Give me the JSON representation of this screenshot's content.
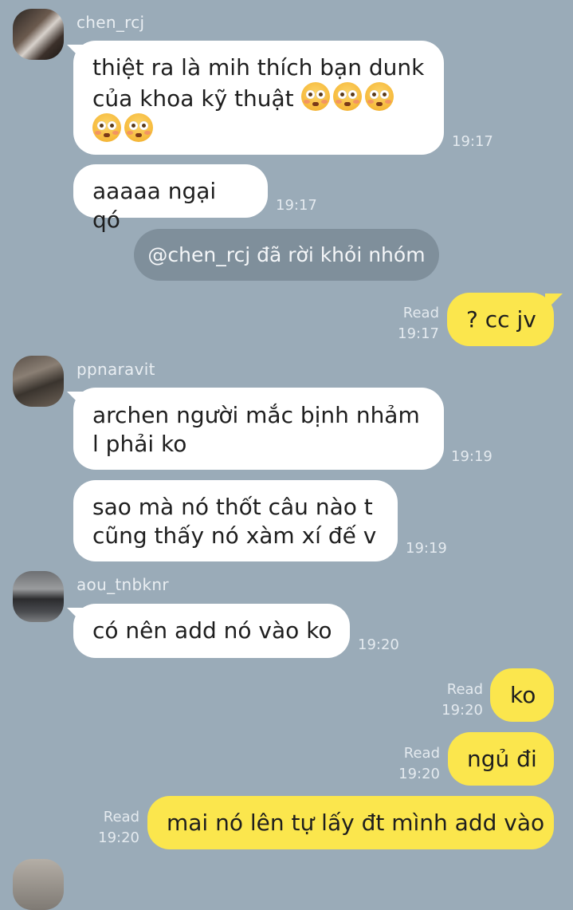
{
  "messages": [
    {
      "sender": "chen_rcj",
      "text_line1": "thiệt ra là mih thích bạn dunk",
      "text_line2": "của khoa kỹ thuật",
      "time": "19:17",
      "emoji_name": "flushed-face-icon"
    },
    {
      "text": "aaaaa ngại qó",
      "time": "19:17"
    },
    {
      "notice": "@chen_rcj đã rời khỏi nhóm"
    },
    {
      "status": "Read",
      "time": "19:17",
      "text": "? cc jv"
    },
    {
      "sender": "ppnaravit",
      "text_line1": "archen người mắc bịnh nhảm",
      "text_line2": "l phải ko",
      "time": "19:19"
    },
    {
      "text_line1": "sao mà nó thốt câu nào t",
      "text_line2": "cũng thấy nó xàm xí đế v",
      "time": "19:19"
    },
    {
      "sender": "aou_tnbknr",
      "text": "có nên add nó vào ko",
      "time": "19:20"
    },
    {
      "status": "Read",
      "time": "19:20",
      "text": "ko"
    },
    {
      "status": "Read",
      "time": "19:20",
      "text": "ngủ đi"
    },
    {
      "status": "Read",
      "time": "19:20",
      "text": "mai nó lên tự lấy đt mình add vào"
    }
  ]
}
